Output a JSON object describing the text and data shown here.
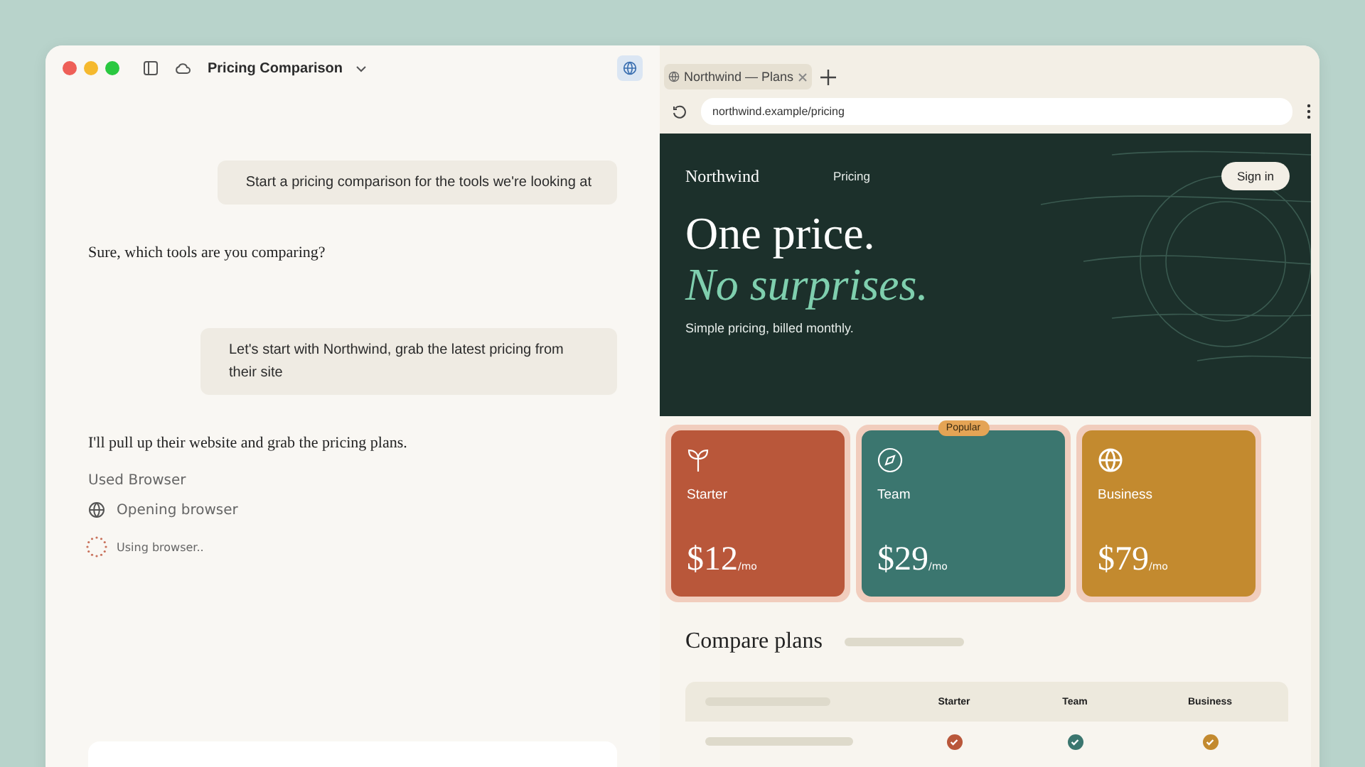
{
  "window": {
    "title": "Pricing Comparison",
    "browser_active": true
  },
  "conversation": [
    {
      "kind": "user",
      "text": "Start a pricing comparison for the tools we're looking at"
    },
    {
      "kind": "assistant",
      "text": "Sure, which tools are you comparing?"
    },
    {
      "kind": "user",
      "text": "Let's start with Northwind, grab the latest pricing from their site"
    },
    {
      "kind": "assistant",
      "text": "I'll pull up their website and grab the pricing plans."
    },
    {
      "kind": "tool_label",
      "text": "Used Browser"
    },
    {
      "kind": "tool_step",
      "text": "Opening browser"
    },
    {
      "kind": "progress",
      "text": "Using browser.."
    }
  ],
  "browser": {
    "tabs": [
      {
        "label": "Northwind — Plans",
        "selected": true
      }
    ],
    "url": "northwind.example/pricing"
  },
  "site": {
    "brand": "Northwind",
    "nav": [
      "Pricing"
    ],
    "sign_in": "Sign in",
    "headline": "One price.",
    "headline_accent": "No surprises.",
    "subtitle": "Simple pricing, billed monthly."
  },
  "plans": [
    {
      "name": "Starter",
      "price": "$12",
      "unit": "/mo",
      "color": "#b9573a"
    },
    {
      "name": "Team",
      "price": "$29",
      "unit": "/mo",
      "color": "#3b766f",
      "badge": "Popular"
    },
    {
      "name": "Business",
      "price": "$79",
      "unit": "/mo",
      "color": "#c38a2f"
    }
  ],
  "compare": {
    "title": "Compare plans",
    "columns": [
      "Starter",
      "Team",
      "Business"
    ],
    "rows": [
      {
        "cells": [
          {
            "checked": true
          },
          {
            "checked": true
          },
          {
            "checked": true
          }
        ]
      }
    ]
  }
}
